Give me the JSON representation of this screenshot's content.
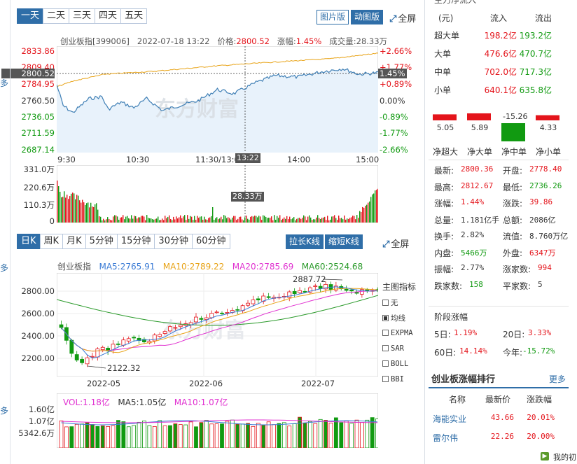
{
  "time_tabs": [
    "一天",
    "二天",
    "三天",
    "四天",
    "五天"
  ],
  "view_buttons": {
    "image": "图片版",
    "animated": "动图版"
  },
  "fullscreen": "全屏",
  "intraday_info": {
    "name": "创业板指[399006]",
    "datetime": "2022-07-18 13:22",
    "price_label": "价格:",
    "price": "2800.52",
    "change_label": "涨幅:",
    "change": "1.45%",
    "volume_label": "成交量:",
    "volume": "28.33万"
  },
  "intraday_y_left": [
    "2833.86",
    "2809.40",
    "2800.52",
    "2784.95",
    "2760.50",
    "2736.05",
    "2711.59",
    "2687.14"
  ],
  "intraday_y_right": [
    "+2.66%",
    "+1.77%",
    "1.45%",
    "+0.89%",
    "0.00%",
    "-0.89%",
    "-1.77%",
    "-2.66%"
  ],
  "intraday_x": [
    "9:30",
    "10:30",
    "11:30/13:00",
    "13:22",
    "14:00",
    "15:00"
  ],
  "volume_y": [
    "331.0万",
    "220.6万",
    "110.3万",
    "0"
  ],
  "volume_tag": "28.33万",
  "watermark": "东方财富",
  "kline_tabs": [
    "日K",
    "周K",
    "月K",
    "5分钟",
    "15分钟",
    "30分钟",
    "60分钟"
  ],
  "kline_buttons": {
    "long": "拉长K线",
    "short": "缩短K线"
  },
  "kline_info": {
    "name": "创业板指",
    "ma5_label": "MA5:",
    "ma5": "2765.91",
    "ma10_label": "MA10:",
    "ma10": "2789.22",
    "ma20_label": "MA20:",
    "ma20": "2785.69",
    "ma60_label": "MA60:",
    "ma60": "2524.68"
  },
  "kline_y": [
    "2800.00",
    "2600.00",
    "2400.00",
    "2200.00"
  ],
  "kline_x": [
    "2022-05",
    "2022-06",
    "2022-07"
  ],
  "kline_high_label": "2887.72",
  "kline_low_label": "2122.32",
  "indicator_title": "主图指标",
  "indicators": [
    {
      "label": "无",
      "checked": false
    },
    {
      "label": "均线",
      "checked": true
    },
    {
      "label": "EXPMA",
      "checked": false
    },
    {
      "label": "SAR",
      "checked": false
    },
    {
      "label": "BOLL",
      "checked": false
    },
    {
      "label": "BBI",
      "checked": false
    }
  ],
  "vol_info": {
    "vol_label": "VOL:",
    "vol": "1.18亿",
    "ma5_label": "MA5:",
    "ma5": "1.05亿",
    "ma10_label": "MA10:",
    "ma10": "1.07亿"
  },
  "vol_y": [
    "1.60亿",
    "1.07亿",
    "5342.6万"
  ],
  "left_cut_labels": [
    "多",
    "多",
    "多"
  ],
  "flow_header": [
    "(元)",
    "流入",
    "流出"
  ],
  "flow_title_cut": "主力净流入",
  "flow_rows": [
    {
      "name": "超大单",
      "in": "198.2亿",
      "out": "193.2亿"
    },
    {
      "name": "大单",
      "in": "476.6亿",
      "out": "470.7亿"
    },
    {
      "name": "中单",
      "in": "702.0亿",
      "out": "717.3亿"
    },
    {
      "name": "小单",
      "in": "640.1亿",
      "out": "635.8亿"
    }
  ],
  "net_bars": [
    {
      "label": "净超大",
      "value": "5.05",
      "num": 5.05
    },
    {
      "label": "净大单",
      "value": "5.89",
      "num": 5.89
    },
    {
      "label": "净中单",
      "value": "-15.26",
      "num": -15.26
    },
    {
      "label": "净小单",
      "value": "4.33",
      "num": 4.33
    }
  ],
  "quote": [
    [
      "最新:",
      "2800.36",
      "开盘:",
      "2778.40"
    ],
    [
      "最高:",
      "2812.67",
      "最低:",
      "2736.26"
    ],
    [
      "涨幅:",
      "1.44%",
      "涨跌:",
      "39.86"
    ],
    [
      "总量:",
      "1.181亿手",
      "总额:",
      "2086亿"
    ],
    [
      "换手:",
      "2.82%",
      "流值:",
      "8.760万亿"
    ],
    [
      "内盘:",
      "5466万",
      "外盘:",
      "6347万"
    ],
    [
      "振幅:",
      "2.77%",
      "涨家数:",
      "994"
    ],
    [
      "跌家数:",
      "158",
      "平家数:",
      "5"
    ]
  ],
  "stage_title": "阶段涨幅",
  "stage": [
    [
      "5日:",
      "1.19%",
      "20日:",
      "3.33%"
    ],
    [
      "60日:",
      "14.14%",
      "今年:",
      "-15.72%"
    ]
  ],
  "rank_title": "创业板涨幅排行",
  "rank_more": "更多",
  "rank_header": [
    "名称",
    "最新价",
    "涨跌幅"
  ],
  "rank_rows": [
    {
      "name": "海能实业",
      "price": "43.66",
      "chg": "20.01%"
    },
    {
      "name": "雷尔伟",
      "price": "22.26",
      "chg": "20.00%"
    }
  ],
  "footer_cut": "我的初",
  "colors": {
    "accent": "#2f6ea8",
    "up": "#e4141b",
    "down": "#119a11",
    "ma5": "#3a7bd5",
    "ma10": "#e8a317",
    "ma20": "#e030d0",
    "ma60": "#2a9a2a"
  }
}
